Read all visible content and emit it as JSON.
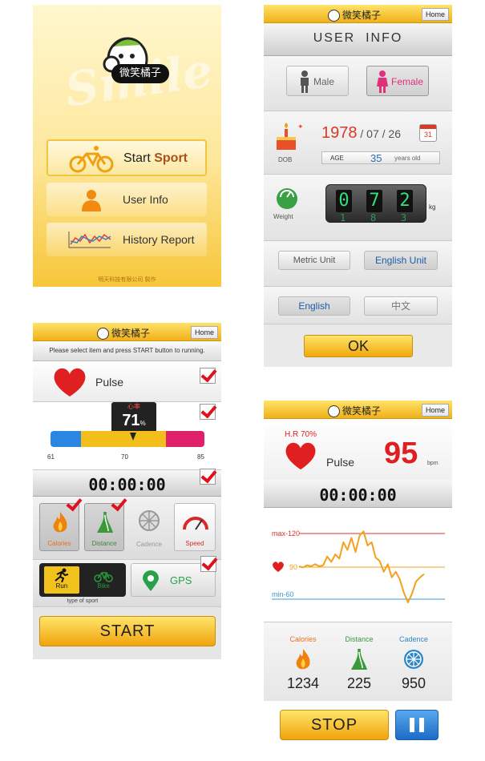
{
  "splash": {
    "brand": "微笑橘子",
    "smile_watermark": "Smile",
    "menu": [
      {
        "label_plain": "Start ",
        "label_bold": "Sport",
        "icon": "bicycle-icon"
      },
      {
        "label_plain": "User Info",
        "label_bold": "",
        "icon": "user-icon"
      },
      {
        "label_plain": "History Report",
        "label_bold": "",
        "icon": "chart-icon"
      }
    ],
    "footer": "明天科技有限公司 製作"
  },
  "user_info": {
    "brand": "微笑橘子",
    "home": "Home",
    "title": "USER  INFO",
    "male": "Male",
    "female": "Female",
    "dob_year": "1978",
    "dob_month": "07",
    "dob_day": "26",
    "dob_label": "DOB",
    "age_label": "AGE",
    "age_value": "35",
    "age_unit": "years old",
    "weight_label": "Weight",
    "weight_digits": [
      "0",
      "7",
      "2"
    ],
    "weight_digits_next": [
      "1",
      "8",
      "3"
    ],
    "weight_unit": "kg",
    "metric_unit": "Metric Unit",
    "english_unit": "English Unit",
    "lang_english": "English",
    "lang_chinese": "中文",
    "ok": "OK",
    "calendar_day": "31"
  },
  "sport_setup": {
    "brand": "微笑橘子",
    "home": "Home",
    "instruction": "Please select item and press START button to running.",
    "pulse_label": "Pulse",
    "hr_tag": "心率",
    "hr_value": "71",
    "hr_unit": "%",
    "scale_min": "61",
    "scale_mid": "70",
    "scale_max": "85",
    "timer": "00:00:00",
    "metrics": [
      "Calories",
      "Distance",
      "Cadence",
      "Speed"
    ],
    "run": "Run",
    "bike": "Bike",
    "gps": "GPS",
    "type_of_sport": "type of sport",
    "start": "START"
  },
  "running": {
    "brand": "微笑橘子",
    "home": "Home",
    "hr_percent": "H.R 70%",
    "pulse_label": "Pulse",
    "bpm_value": "95",
    "bpm_unit": "bpm",
    "timer": "00:00:00",
    "max_label": "max-120",
    "mid_label": "90",
    "min_label": "min-60",
    "stats": [
      {
        "label": "Calories",
        "value": "1234",
        "color": "#e8701a"
      },
      {
        "label": "Distance",
        "value": "225",
        "color": "#3a9a3a"
      },
      {
        "label": "Cadence",
        "value": "950",
        "color": "#2a86c8"
      }
    ],
    "stop": "STOP"
  },
  "colors": {
    "brand_yellow": "#f3b012",
    "alert_red": "#e0101c",
    "female_pink": "#e0307a",
    "digit_green": "#33e07a",
    "max_line": "#e23030",
    "mid_line": "#f0a020",
    "min_line": "#3a98d8"
  },
  "chart_data": {
    "type": "line",
    "series": [
      {
        "name": "",
        "values": [
          90,
          89,
          91,
          90,
          92,
          90,
          91,
          99,
          94,
          101,
          97,
          112,
          105,
          116,
          103,
          118,
          122,
          109,
          112,
          98,
          95,
          85,
          92,
          80,
          85,
          78,
          66,
          57,
          65,
          76,
          80,
          83
        ]
      }
    ],
    "ylim": [
      50,
      130
    ],
    "reference_lines": [
      {
        "label": "max-120",
        "y": 120
      },
      {
        "label": "90",
        "y": 90
      },
      {
        "label": "min-60",
        "y": 60
      }
    ]
  }
}
